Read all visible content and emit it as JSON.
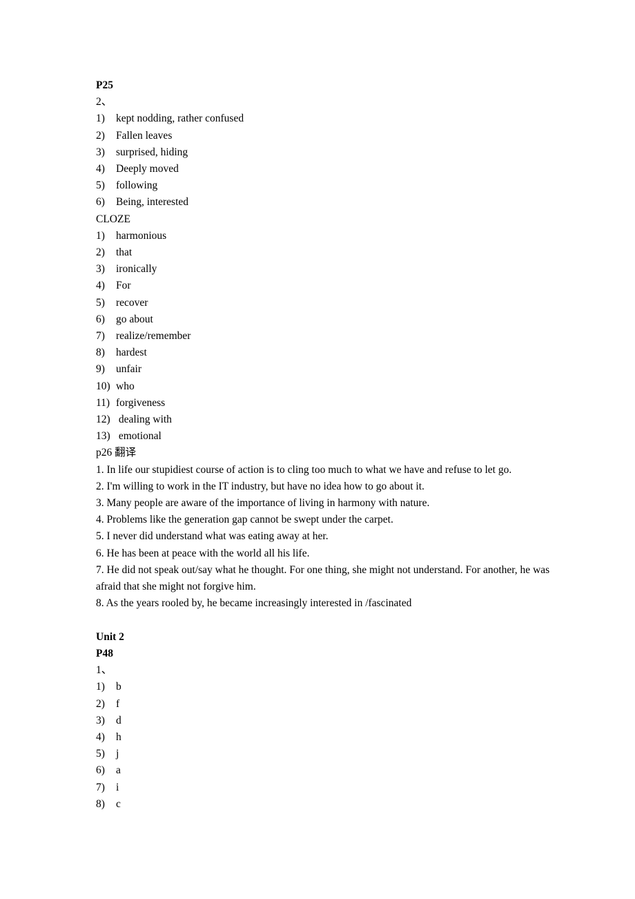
{
  "document": {
    "page_background": "#ffffff",
    "text_color": "#000000"
  },
  "sections": [
    {
      "id": "p25",
      "heading": "P25",
      "subheading": "2、",
      "list": [
        {
          "marker": "1)",
          "text": "kept nodding, rather confused"
        },
        {
          "marker": "2)",
          "text": "Fallen leaves"
        },
        {
          "marker": "3)",
          "text": "surprised, hiding"
        },
        {
          "marker": "4)",
          "text": "Deeply moved"
        },
        {
          "marker": "5)",
          "text": "following"
        },
        {
          "marker": "6)",
          "text": "Being, interested"
        }
      ]
    },
    {
      "id": "cloze",
      "heading": "CLOZE",
      "list": [
        {
          "marker": "1)",
          "text": "harmonious"
        },
        {
          "marker": "2)",
          "text": "that"
        },
        {
          "marker": "3)",
          "text": "ironically"
        },
        {
          "marker": "4)",
          "text": "For"
        },
        {
          "marker": "5)",
          "text": "recover"
        },
        {
          "marker": "6)",
          "text": "go about"
        },
        {
          "marker": "7)",
          "text": "realize/remember"
        },
        {
          "marker": "8)",
          "text": "hardest"
        },
        {
          "marker": "9)",
          "text": "unfair"
        },
        {
          "marker": "10)",
          "text": "who"
        },
        {
          "marker": "11)",
          "text": "forgiveness"
        },
        {
          "marker": "12)",
          "text": " dealing with"
        },
        {
          "marker": "13)",
          "text": " emotional"
        }
      ]
    },
    {
      "id": "p26",
      "heading": "p26 翻译",
      "sentences": [
        "1. In life our stupidiest course of action is to cling too much to what we have and refuse to let go.",
        "2. I'm willing to work in the IT industry, but have no idea how to go about it.",
        "3. Many people are aware of the importance of living in harmony with nature.",
        "4. Problems like the generation gap cannot be swept under the carpet.",
        "5. I never did understand what was eating away at her.",
        "6. He has been at peace with the world all his life.",
        "7. He did not speak out/say what he thought. For one thing, she might not understand. For another, he was afraid that she might not forgive him.",
        "8. As the years rooled by, he became increasingly interested in /fascinated"
      ]
    },
    {
      "id": "unit2",
      "unit_title": "Unit 2",
      "heading": "P48",
      "subheading": "1、",
      "list": [
        {
          "marker": "1)",
          "text": "b"
        },
        {
          "marker": "2)",
          "text": "f"
        },
        {
          "marker": "3)",
          "text": "d"
        },
        {
          "marker": "4)",
          "text": "h"
        },
        {
          "marker": "5)",
          "text": "j"
        },
        {
          "marker": "6)",
          "text": "a"
        },
        {
          "marker": "7)",
          "text": "i"
        },
        {
          "marker": "8)",
          "text": "c"
        }
      ]
    }
  ]
}
